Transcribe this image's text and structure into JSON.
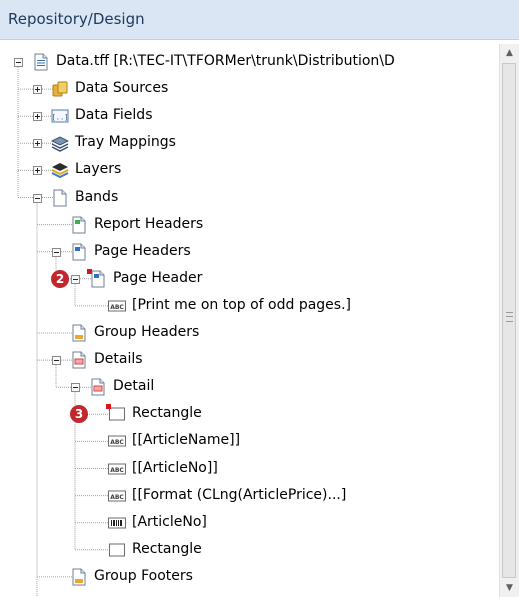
{
  "panel": {
    "title": "Repository/Design"
  },
  "tree": {
    "items": [
      {
        "label": "Data.tff [R:\\TEC-IT\\TFORMer\\trunk\\Distribution\\D",
        "icon": "document-icon",
        "expander": "minus"
      },
      {
        "label": "Data Sources",
        "icon": "database-icon",
        "expander": "plus"
      },
      {
        "label": "Data Fields",
        "icon": "data-field-icon",
        "expander": "plus"
      },
      {
        "label": "Tray Mappings",
        "icon": "tray-icon",
        "expander": "plus"
      },
      {
        "label": "Layers",
        "icon": "layers-icon",
        "expander": "plus"
      },
      {
        "label": "Bands",
        "icon": "page-icon",
        "expander": "minus"
      },
      {
        "label": "Report Headers",
        "icon": "band-green-icon"
      },
      {
        "label": "Page Headers",
        "icon": "band-blue-icon",
        "expander": "minus"
      },
      {
        "label": "Page Header",
        "icon": "band-blue-icon",
        "expander": "minus",
        "badge": "2"
      },
      {
        "label": "[Print me on top of odd pages.]",
        "icon": "text-field-icon"
      },
      {
        "label": "Group Headers",
        "icon": "band-orange-icon"
      },
      {
        "label": "Details",
        "icon": "band-red-icon",
        "expander": "minus"
      },
      {
        "label": "Detail",
        "icon": "band-red-icon",
        "expander": "minus"
      },
      {
        "label": "Rectangle",
        "icon": "rectangle-icon",
        "badge": "3"
      },
      {
        "label": "[[ArticleName]]",
        "icon": "text-field-icon"
      },
      {
        "label": "[[ArticleNo]]",
        "icon": "text-field-icon"
      },
      {
        "label": "[[Format (CLng(ArticlePrice)...]",
        "icon": "text-field-icon"
      },
      {
        "label": "[ArticleNo]",
        "icon": "barcode-icon"
      },
      {
        "label": "Rectangle",
        "icon": "rectangle-icon"
      },
      {
        "label": "Group Footers",
        "icon": "band-orange-icon"
      }
    ]
  },
  "icon_text": {
    "abc": "ABC",
    "fields": "[..]"
  },
  "scrollbar": {
    "up": "▲",
    "down": "▼"
  }
}
